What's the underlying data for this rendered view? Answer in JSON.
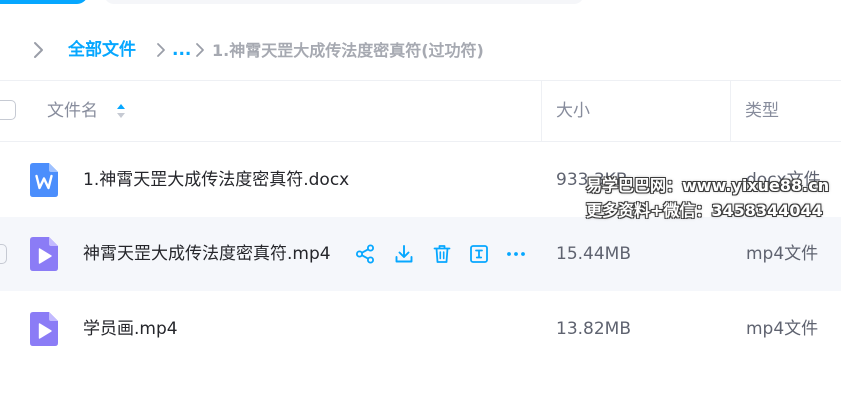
{
  "breadcrumb": {
    "root": "全部文件",
    "ellipsis": "...",
    "current": "1.神霄天罡大成传法度密真符(过功符)"
  },
  "table": {
    "columns": {
      "name": "文件名",
      "size": "大小",
      "type": "类型"
    },
    "rows": [
      {
        "name": "1.神霄天罡大成传法度密真符.docx",
        "size": "933.3KB",
        "type": "docx文件",
        "icon": "word-file-icon"
      },
      {
        "name": "神霄天罡大成传法度密真符.mp4",
        "size": "15.44MB",
        "type": "mp4文件",
        "icon": "video-file-icon"
      },
      {
        "name": "学员画.mp4",
        "size": "13.82MB",
        "type": "mp4文件",
        "icon": "video-file-icon"
      }
    ],
    "row_actions": [
      "share-icon",
      "download-icon",
      "delete-icon",
      "rename-icon",
      "more-icon"
    ]
  },
  "watermark": {
    "line1": "易学巴巴网：www.yixue88.cn",
    "line2": "更多资料+微信：3458344044"
  },
  "colors": {
    "accent": "#06a7ff",
    "hover_row": "#f5f7fb",
    "word_icon": "#4b8efc",
    "video_icon": "#8b7cf6"
  }
}
